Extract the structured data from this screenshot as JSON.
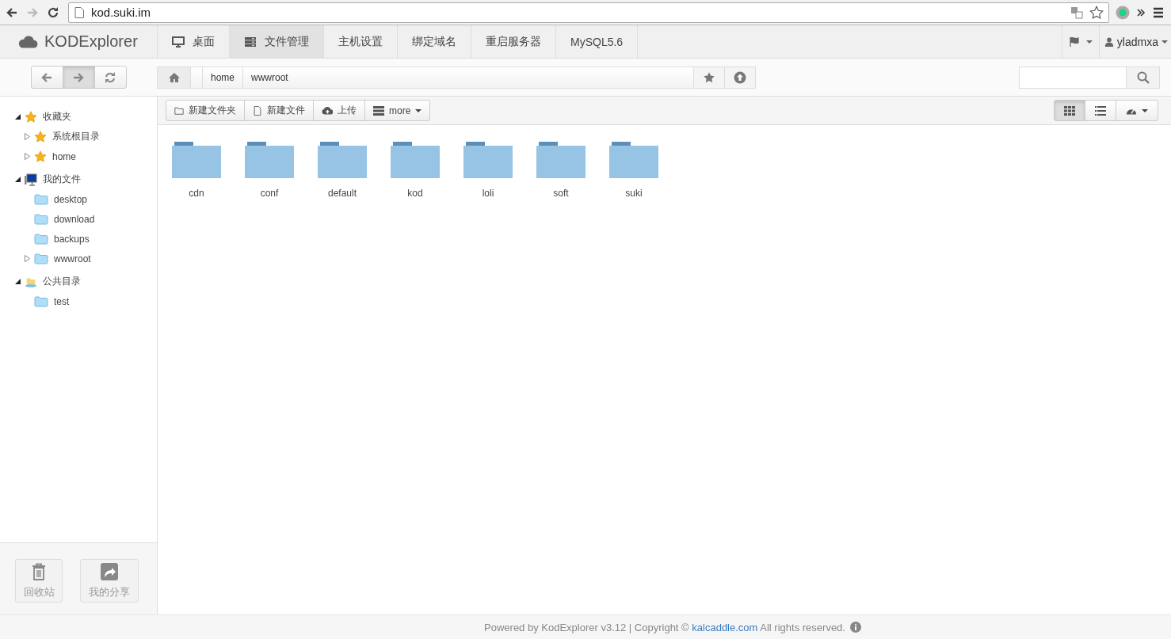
{
  "browser": {
    "url": "kod.suki.im",
    "nav": [
      {
        "kind": "back",
        "disabled": false
      },
      {
        "kind": "forward",
        "disabled": true
      },
      {
        "kind": "reload",
        "disabled": false
      }
    ]
  },
  "app": {
    "logo": "KODExplorer",
    "user": "yladmxa"
  },
  "tabs": [
    {
      "label": "桌面",
      "selected": false
    },
    {
      "label": "文件管理",
      "selected": true
    },
    {
      "label": "主机设置",
      "selected": false
    },
    {
      "label": "绑定域名",
      "selected": false
    },
    {
      "label": "重启服务器",
      "selected": false
    },
    {
      "label": "MySQL5.6",
      "selected": false
    }
  ],
  "history_buttons": [
    {
      "kind": "back",
      "selected": false
    },
    {
      "kind": "forward",
      "selected": true
    },
    {
      "kind": "refresh",
      "selected": false
    }
  ],
  "breadcrumb": [
    "home",
    "wwwroot"
  ],
  "toolbar": [
    "新建文件夹",
    "新建文件",
    "上传",
    "more"
  ],
  "view_buttons": [
    {
      "kind": "grid",
      "selected": true
    },
    {
      "kind": "list",
      "selected": false
    },
    {
      "kind": "theme",
      "selected": false
    }
  ],
  "tree": [
    {
      "label": "收藏夹",
      "kind": "branch",
      "expanded": true,
      "children": [
        {
          "label": "系统根目录",
          "kind": "branch",
          "expanded": false
        },
        {
          "label": "home",
          "kind": "branch",
          "expanded": false
        }
      ]
    },
    {
      "label": "我的文件",
      "kind": "branch",
      "expanded": true,
      "children": [
        {
          "label": "desktop",
          "kind": "leaf"
        },
        {
          "label": "download",
          "kind": "leaf"
        },
        {
          "label": "backups",
          "kind": "leaf"
        },
        {
          "label": "wwwroot",
          "kind": "branch",
          "expanded": false
        }
      ]
    },
    {
      "label": "公共目录",
      "kind": "branch",
      "expanded": true,
      "children": [
        {
          "label": "test",
          "kind": "leaf"
        }
      ]
    }
  ],
  "sidebar_buttons": [
    "回收站",
    "我的分享"
  ],
  "files": [
    "cdn",
    "conf",
    "default",
    "kod",
    "loli",
    "soft",
    "suki"
  ],
  "footer": {
    "text": "Powered by KodExplorer v3.12 | Copyright ©",
    "link": "kalcaddle.com",
    "suffix": "All rights reserved."
  }
}
